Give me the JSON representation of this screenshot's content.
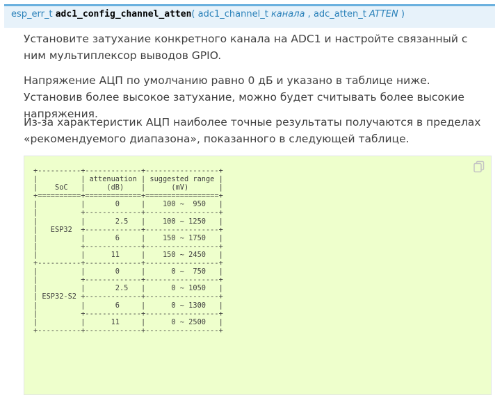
{
  "signature": {
    "return_type": "esp_err_t",
    "function_name": "adc1_config_channel_atten",
    "open_paren": "(",
    "param1_type": "adc1_channel_t",
    "param1_name": "канала",
    "separator": ",",
    "param2_type": "adc_atten_t",
    "param2_name": "ATTEN",
    "close_paren": ")"
  },
  "paragraphs": [
    "Установите затухание конкретного канала на ADC1 и настройте связанный с ним мультиплексор выводов GPIO.",
    "Напряжение АЦП по умолчанию равно 0 дБ и указано в таблице ниже. Установив более высокое затухание, можно будет считывать более высокие напряжения.",
    "Из-за характеристик АЦП наиболее точные результаты получаются в пределах «рекомендуемого диапазона», показанного в следующей таблице."
  ],
  "code_block": {
    "copy_icon": "copy-icon",
    "text": "+----------+-------------+-----------------+\n|          | attenuation | suggested range |\n|    SoC   |     (dB)    |      (mV)       |\n+==========+=============+=================+\n|          |       0     |    100 ~  950   |\n|          +-------------+-----------------+\n|          |       2.5   |    100 ~ 1250   |\n|   ESP32  +-------------+-----------------+\n|          |       6     |    150 ~ 1750   |\n|          +-------------+-----------------+\n|          |      11     |    150 ~ 2450   |\n+----------+-------------+-----------------+\n|          |       0     |      0 ~  750   |\n|          +-------------+-----------------+\n|          |       2.5   |      0 ~ 1050   |\n| ESP32-S2 +-------------+-----------------+\n|          |       6     |      0 ~ 1300   |\n|          +-------------+-----------------+\n|          |      11     |      0 ~ 2500   |\n+----------+-------------+-----------------+"
  },
  "colors": {
    "signature_bg": "#e7f2fa",
    "signature_border": "#6ab0de",
    "link": "#2980b9",
    "text": "#404040",
    "code_bg": "#eeffcc"
  }
}
